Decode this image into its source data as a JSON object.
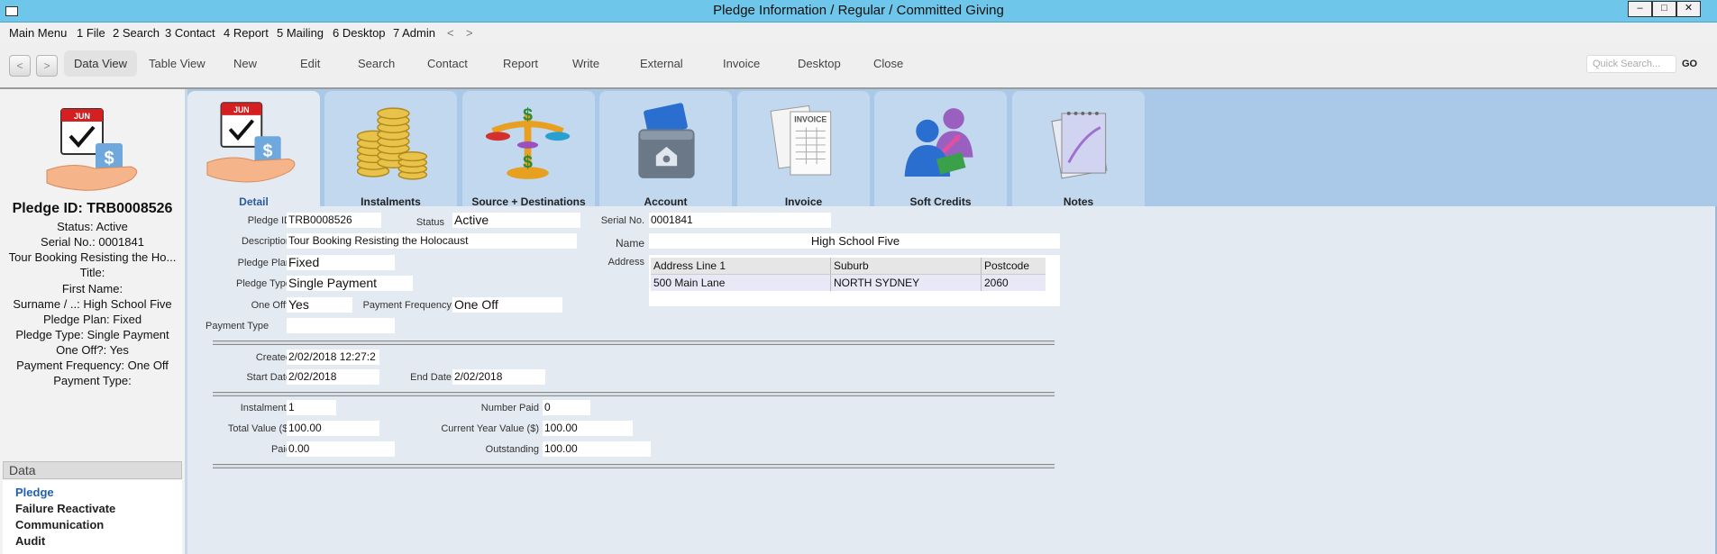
{
  "window": {
    "title": "Pledge Information / Regular / Committed Giving"
  },
  "menu": [
    "Main Menu",
    "1 File",
    "2 Search",
    "3 Contact",
    "4 Report",
    "5 Mailing",
    "6 Desktop",
    "7 Admin",
    "<",
    ">"
  ],
  "toolbar": {
    "buttons": [
      "Data View",
      "Table View",
      "New",
      "Edit",
      "Search",
      "Contact",
      "Report",
      "Write",
      "External",
      "Invoice",
      "Desktop",
      "Close"
    ],
    "quick_search_placeholder": "Quick Search...",
    "go": "GO"
  },
  "summary": {
    "pledge_id": "Pledge ID: TRB0008526",
    "lines": [
      "Status: Active",
      "Serial No.: 0001841",
      "Tour Booking Resisting the Ho...",
      "Title:",
      "First Name:",
      "Surname / ..: High School Five",
      "Pledge Plan: Fixed",
      "Pledge Type: Single Payment",
      "One Off?: Yes",
      "Payment Frequency: One Off",
      "Payment Type:"
    ]
  },
  "data_section": {
    "header": "Data",
    "items": [
      "Pledge",
      "Failure Reactivate",
      "Communication",
      "Audit"
    ]
  },
  "tabs": [
    "Detail",
    "Instalments",
    "Source + Destinations",
    "Account",
    "Invoice",
    "Soft Credits",
    "Notes"
  ],
  "form": {
    "pledge_id": {
      "label": "Pledge ID",
      "value": "TRB0008526"
    },
    "status": {
      "label": "Status",
      "value": "Active"
    },
    "serial_no": {
      "label": "Serial No.",
      "value": "0001841"
    },
    "description": {
      "label": "Description",
      "value": "Tour Booking Resisting the Holocaust"
    },
    "name": {
      "label": "Name",
      "value": "High School Five"
    },
    "pledge_plan": {
      "label": "Pledge Plan",
      "value": "Fixed"
    },
    "address": {
      "label": "Address"
    },
    "pledge_type": {
      "label": "Pledge Type",
      "value": "Single Payment"
    },
    "one_off": {
      "label": "One Off?",
      "value": "Yes"
    },
    "payment_frequency": {
      "label": "Payment Frequency",
      "value": "One Off"
    },
    "payment_type": {
      "label": "Payment Type",
      "value": ""
    },
    "created": {
      "label": "Created",
      "value": "2/02/2018 12:27:2"
    },
    "start_date": {
      "label": "Start Date",
      "value": "2/02/2018"
    },
    "end_date": {
      "label": "End Date",
      "value": "2/02/2018"
    },
    "instalments": {
      "label": "Instalments",
      "value": "1"
    },
    "number_paid": {
      "label": "Number Paid",
      "value": "0"
    },
    "total_value": {
      "label": "Total Value ($)",
      "value": "100.00"
    },
    "current_year_value": {
      "label": "Current Year Value ($)",
      "value": "100.00"
    },
    "paid": {
      "label": "Paid",
      "value": "0.00"
    },
    "outstanding": {
      "label": "Outstanding",
      "value": "100.00"
    }
  },
  "address_table": {
    "columns": [
      "Address Line 1",
      "Suburb",
      "Postcode"
    ],
    "rows": [
      [
        "500 Main Lane",
        "NORTH SYDNEY",
        "2060"
      ]
    ]
  },
  "icons": [
    "pledge-calendar-hand-icon",
    "coins-icon",
    "scales-icon",
    "credit-card-wallet-icon",
    "invoice-icon",
    "people-credits-icon",
    "notepad-icon"
  ]
}
